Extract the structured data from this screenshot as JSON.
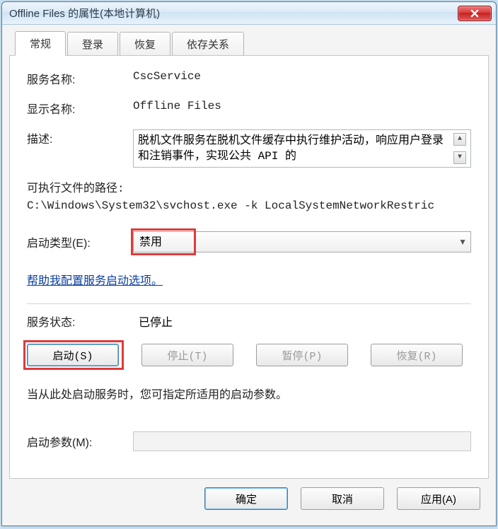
{
  "window": {
    "title": "Offline Files 的属性(本地计算机)"
  },
  "tabs": {
    "general": "常规",
    "logon": "登录",
    "recovery": "恢复",
    "depend": "依存关系"
  },
  "general": {
    "service_name_label": "服务名称:",
    "service_name_value": "CscService",
    "display_name_label": "显示名称:",
    "display_name_value": "Offline Files",
    "description_label": "描述:",
    "description_value": "脱机文件服务在脱机文件缓存中执行维护活动，响应用户登录和注销事件，实现公共 API 的",
    "path_label": "可执行文件的路径:",
    "path_value": "C:\\Windows\\System32\\svchost.exe -k LocalSystemNetworkRestric",
    "startup_label": "启动类型(E):",
    "startup_value": "禁用",
    "help_link": "帮助我配置服务启动选项。",
    "status_label": "服务状态:",
    "status_value": "已停止",
    "btn_start": "启动(S)",
    "btn_stop": "停止(T)",
    "btn_pause": "暂停(P)",
    "btn_resume": "恢复(R)",
    "hint": "当从此处启动服务时，您可指定所适用的启动参数。",
    "params_label": "启动参数(M):"
  },
  "footer": {
    "ok": "确定",
    "cancel": "取消",
    "apply": "应用(A)"
  }
}
